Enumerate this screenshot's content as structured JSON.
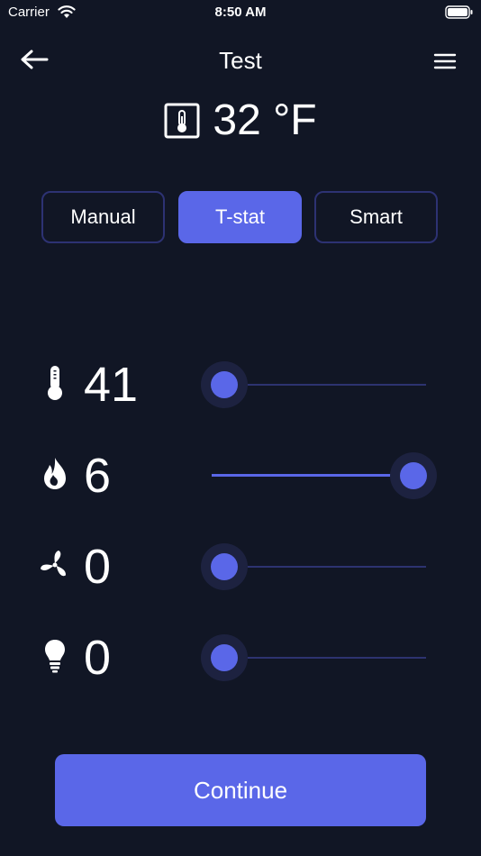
{
  "status_bar": {
    "carrier": "Carrier",
    "time": "8:50 AM"
  },
  "nav": {
    "title": "Test"
  },
  "temperature": {
    "value": "32 °F"
  },
  "tabs": [
    {
      "label": "Manual",
      "active": false
    },
    {
      "label": "T-stat",
      "active": true
    },
    {
      "label": "Smart",
      "active": false
    }
  ],
  "sliders": [
    {
      "name": "temperature-setpoint",
      "icon": "thermometer-icon",
      "value": "41",
      "fraction": 0.06
    },
    {
      "name": "flame-level",
      "icon": "flame-icon",
      "value": "6",
      "fraction": 0.94
    },
    {
      "name": "fan-speed",
      "icon": "fan-icon",
      "value": "0",
      "fraction": 0.06
    },
    {
      "name": "light-level",
      "icon": "bulb-icon",
      "value": "0",
      "fraction": 0.06
    }
  ],
  "continue_button": {
    "label": "Continue"
  },
  "colors": {
    "background": "#111625",
    "accent": "#5a67e8",
    "track": "#2d3370",
    "tab_border": "#2d3273"
  }
}
